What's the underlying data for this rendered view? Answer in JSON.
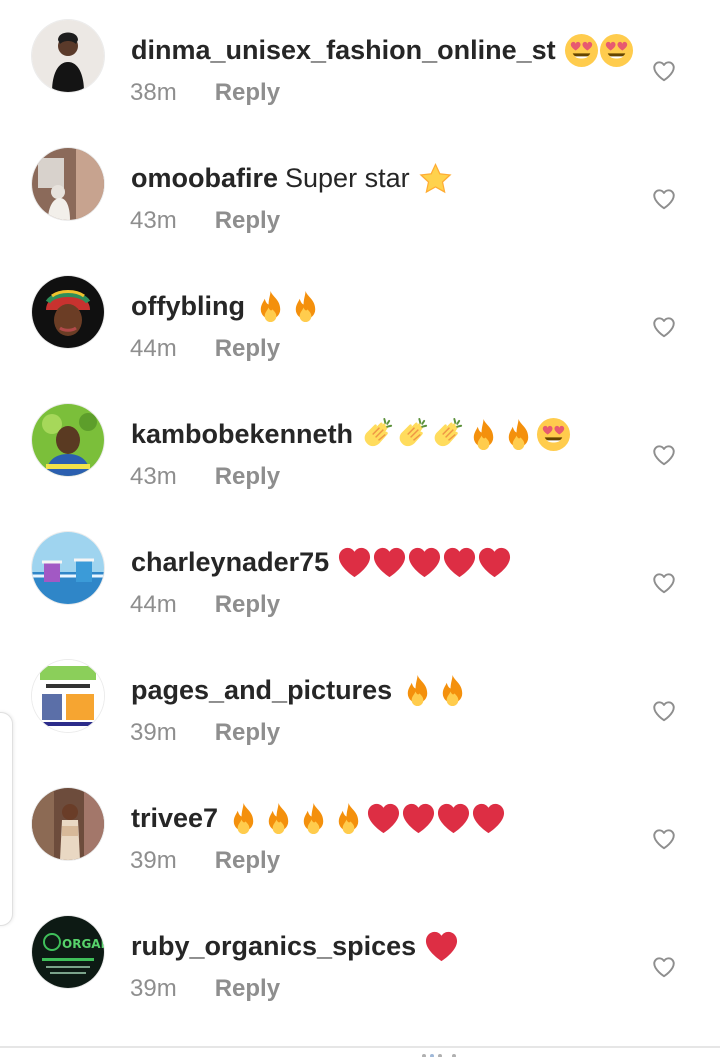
{
  "comments": [
    {
      "username": "dinma_unisex_fashion_online_st",
      "text": "",
      "emojis": [
        "heart-eyes",
        "heart-eyes"
      ],
      "time": "38m",
      "reply": "Reply",
      "avatar": "avatar-woman-black-dress"
    },
    {
      "username": "omoobafire",
      "text": "Super star",
      "emojis": [
        "star"
      ],
      "time": "43m",
      "reply": "Reply",
      "avatar": "avatar-room"
    },
    {
      "username": "offybling",
      "text": "",
      "emojis": [
        "fire",
        "fire"
      ],
      "time": "44m",
      "reply": "Reply",
      "avatar": "avatar-headwrap"
    },
    {
      "username": "kambobekenneth",
      "text": "",
      "emojis": [
        "clap",
        "clap",
        "clap",
        "fire",
        "fire",
        "heart-eyes"
      ],
      "time": "43m",
      "reply": "Reply",
      "avatar": "avatar-man-green"
    },
    {
      "username": "charleynader75",
      "text": "",
      "emojis": [
        "red-heart",
        "red-heart",
        "red-heart",
        "red-heart",
        "red-heart"
      ],
      "time": "44m",
      "reply": "Reply",
      "avatar": "avatar-beach"
    },
    {
      "username": "pages_and_pictures",
      "text": "",
      "emojis": [
        "fire",
        "fire"
      ],
      "time": "39m",
      "reply": "Reply",
      "avatar": "avatar-flyer"
    },
    {
      "username": "trivee7",
      "text": "",
      "emojis": [
        "fire",
        "fire",
        "fire",
        "fire",
        "red-heart",
        "red-heart",
        "red-heart",
        "red-heart"
      ],
      "time": "39m",
      "reply": "Reply",
      "avatar": "avatar-woman-shop"
    },
    {
      "username": "ruby_organics_spices",
      "text": "",
      "emojis": [
        "red-heart"
      ],
      "time": "39m",
      "reply": "Reply",
      "avatar": "avatar-organics-logo"
    }
  ],
  "colors": {
    "username": "#262626",
    "meta": "#8e8e8e",
    "heart_outline": "#8e8e8e",
    "fire": "#f4900c",
    "red_heart": "#dd2e44",
    "emoji_face": "#ffcc4d"
  }
}
